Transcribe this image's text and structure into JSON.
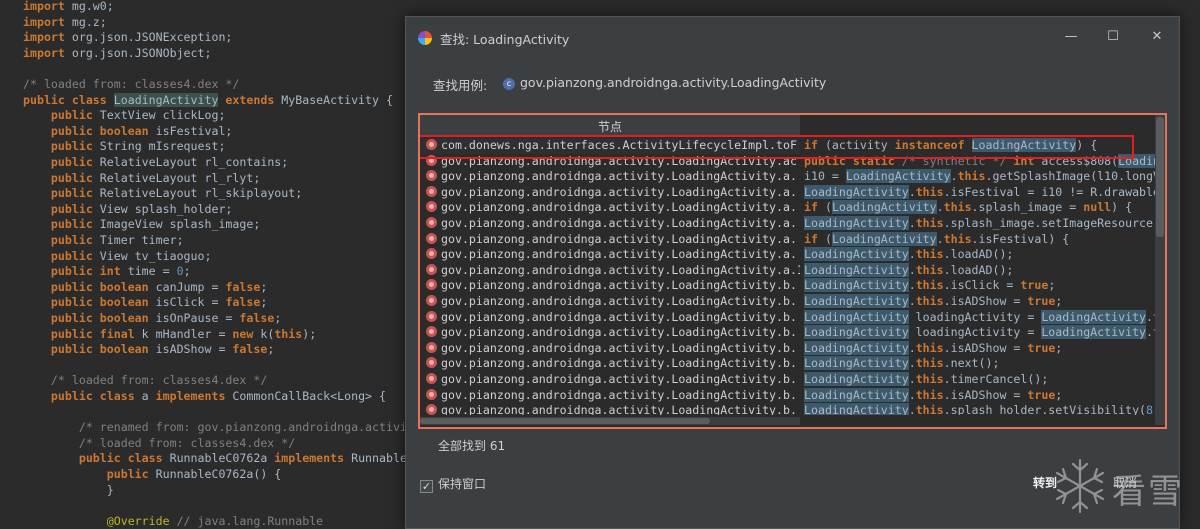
{
  "editor": {
    "lines": [
      {
        "parts": [
          {
            "t": "import",
            "c": "kw"
          },
          {
            "t": " mg.w0;"
          }
        ]
      },
      {
        "parts": [
          {
            "t": "import",
            "c": "kw"
          },
          {
            "t": " mg.z;"
          }
        ]
      },
      {
        "parts": [
          {
            "t": "import",
            "c": "kw"
          },
          {
            "t": " org.json.JSONException;"
          }
        ]
      },
      {
        "parts": [
          {
            "t": "import",
            "c": "kw"
          },
          {
            "t": " org.json.JSONObject;"
          }
        ]
      },
      {
        "parts": [
          {
            "t": ""
          }
        ]
      },
      {
        "parts": [
          {
            "t": "/* loaded from: classes4.dex */",
            "c": "cm"
          }
        ]
      },
      {
        "parts": [
          {
            "t": "public class ",
            "c": "kw"
          },
          {
            "t": "LoadingActivity",
            "c": "hl-sel"
          },
          {
            "t": " extends ",
            "c": "kw"
          },
          {
            "t": "MyBaseActivity {"
          }
        ]
      },
      {
        "parts": [
          {
            "t": "    "
          },
          {
            "t": "public",
            "c": "kw"
          },
          {
            "t": " TextView clickLog;"
          }
        ]
      },
      {
        "parts": [
          {
            "t": "    "
          },
          {
            "t": "public boolean",
            "c": "kw"
          },
          {
            "t": " isFestival;"
          }
        ]
      },
      {
        "parts": [
          {
            "t": "    "
          },
          {
            "t": "public",
            "c": "kw"
          },
          {
            "t": " String mIsrequest;"
          }
        ]
      },
      {
        "parts": [
          {
            "t": "    "
          },
          {
            "t": "public",
            "c": "kw"
          },
          {
            "t": " RelativeLayout rl_contains;"
          }
        ]
      },
      {
        "parts": [
          {
            "t": "    "
          },
          {
            "t": "public",
            "c": "kw"
          },
          {
            "t": " RelativeLayout rl_rlyt;"
          }
        ]
      },
      {
        "parts": [
          {
            "t": "    "
          },
          {
            "t": "public",
            "c": "kw"
          },
          {
            "t": " RelativeLayout rl_skiplayout;"
          }
        ]
      },
      {
        "parts": [
          {
            "t": "    "
          },
          {
            "t": "public",
            "c": "kw"
          },
          {
            "t": " View splash_holder;"
          }
        ]
      },
      {
        "parts": [
          {
            "t": "    "
          },
          {
            "t": "public",
            "c": "kw"
          },
          {
            "t": " ImageView splash_image;"
          }
        ]
      },
      {
        "parts": [
          {
            "t": "    "
          },
          {
            "t": "public",
            "c": "kw"
          },
          {
            "t": " Timer timer;"
          }
        ]
      },
      {
        "parts": [
          {
            "t": "    "
          },
          {
            "t": "public",
            "c": "kw"
          },
          {
            "t": " View tv_tiaoguo;"
          }
        ]
      },
      {
        "parts": [
          {
            "t": "    "
          },
          {
            "t": "public int",
            "c": "kw"
          },
          {
            "t": " time = "
          },
          {
            "t": "0",
            "c": "num"
          },
          {
            "t": ";"
          }
        ]
      },
      {
        "parts": [
          {
            "t": "    "
          },
          {
            "t": "public boolean",
            "c": "kw"
          },
          {
            "t": " canJump = "
          },
          {
            "t": "false",
            "c": "kw"
          },
          {
            "t": ";"
          }
        ]
      },
      {
        "parts": [
          {
            "t": "    "
          },
          {
            "t": "public boolean",
            "c": "kw"
          },
          {
            "t": " isClick = "
          },
          {
            "t": "false",
            "c": "kw"
          },
          {
            "t": ";"
          }
        ]
      },
      {
        "parts": [
          {
            "t": "    "
          },
          {
            "t": "public boolean",
            "c": "kw"
          },
          {
            "t": " isOnPause = "
          },
          {
            "t": "false",
            "c": "kw"
          },
          {
            "t": ";"
          }
        ]
      },
      {
        "parts": [
          {
            "t": "    "
          },
          {
            "t": "public final",
            "c": "kw"
          },
          {
            "t": " k mHandler = "
          },
          {
            "t": "new",
            "c": "kw"
          },
          {
            "t": " k("
          },
          {
            "t": "this",
            "c": "kw"
          },
          {
            "t": ");"
          }
        ]
      },
      {
        "parts": [
          {
            "t": "    "
          },
          {
            "t": "public boolean",
            "c": "kw"
          },
          {
            "t": " isADShow = "
          },
          {
            "t": "false",
            "c": "kw"
          },
          {
            "t": ";"
          }
        ]
      },
      {
        "parts": [
          {
            "t": ""
          }
        ]
      },
      {
        "parts": [
          {
            "t": "    "
          },
          {
            "t": "/* loaded from: classes4.dex */",
            "c": "cm"
          }
        ]
      },
      {
        "parts": [
          {
            "t": "    "
          },
          {
            "t": "public class",
            "c": "kw"
          },
          {
            "t": " a "
          },
          {
            "t": "implements",
            "c": "kw"
          },
          {
            "t": " CommonCallBack<Long> {"
          }
        ]
      },
      {
        "parts": [
          {
            "t": ""
          }
        ]
      },
      {
        "parts": [
          {
            "t": "        "
          },
          {
            "t": "/* renamed from: gov.pianzong.androidnga.activit",
            "c": "cm"
          }
        ]
      },
      {
        "parts": [
          {
            "t": "        "
          },
          {
            "t": "/* loaded from: classes4.dex */",
            "c": "cm"
          }
        ]
      },
      {
        "parts": [
          {
            "t": "        "
          },
          {
            "t": "public class",
            "c": "kw"
          },
          {
            "t": " RunnableC0762a "
          },
          {
            "t": "implements",
            "c": "kw"
          },
          {
            "t": " Runnable"
          }
        ]
      },
      {
        "parts": [
          {
            "t": "            "
          },
          {
            "t": "public",
            "c": "kw"
          },
          {
            "t": " RunnableC0762a() {"
          }
        ]
      },
      {
        "parts": [
          {
            "t": "            }"
          }
        ]
      },
      {
        "parts": [
          {
            "t": ""
          }
        ]
      },
      {
        "parts": [
          {
            "t": "            "
          },
          {
            "t": "@Override",
            "c": "ann"
          },
          {
            "t": " // java.lang.Runnable",
            "c": "cm"
          }
        ]
      }
    ]
  },
  "dialog": {
    "title": "查找: LoadingActivity",
    "minimize": "—",
    "maximize": "☐",
    "close": "✕",
    "use_label": "查找用例:",
    "class_icon_letter": "c",
    "use_target": "gov.pianzong.androidnga.activity.LoadingActivity",
    "column_header": "节点",
    "nodes": [
      "com.donews.nga.interfaces.ActivityLifecycleImpl.toF",
      "gov.pianzong.androidnga.activity.LoadingActivity.ac",
      "gov.pianzong.androidnga.activity.LoadingActivity.a.",
      "gov.pianzong.androidnga.activity.LoadingActivity.a.",
      "gov.pianzong.androidnga.activity.LoadingActivity.a.",
      "gov.pianzong.androidnga.activity.LoadingActivity.a.",
      "gov.pianzong.androidnga.activity.LoadingActivity.a.",
      "gov.pianzong.androidnga.activity.LoadingActivity.a.",
      "gov.pianzong.androidnga.activity.LoadingActivity.a.I",
      "gov.pianzong.androidnga.activity.LoadingActivity.b.",
      "gov.pianzong.androidnga.activity.LoadingActivity.b.",
      "gov.pianzong.androidnga.activity.LoadingActivity.b.",
      "gov.pianzong.androidnga.activity.LoadingActivity.b.",
      "gov.pianzong.androidnga.activity.LoadingActivity.b.",
      "gov.pianzong.androidnga.activity.LoadingActivity.b.",
      "gov.pianzong.androidnga.activity.LoadingActivity.b.",
      "gov.pianzong.androidnga.activity.LoadingActivity.b.",
      "gov.pianzong.androidnga.activity.LoadingActivity.b.",
      "gov.pianzong.androidnga.activity.LoadingActivity.b.",
      "gov.pianzong.androidnga.activity.LoadingActivity.b."
    ],
    "code_lines": [
      {
        "parts": [
          {
            "t": "if",
            "c": "kw"
          },
          {
            "t": " (activity "
          },
          {
            "t": "instanceof",
            "c": "kw"
          },
          {
            "t": " "
          },
          {
            "t": "LoadingActivity",
            "c": "cvh"
          },
          {
            "t": ") {"
          }
        ]
      },
      {
        "parts": [
          {
            "t": "public static",
            "c": "kw"
          },
          {
            "t": " /* synthetic */",
            "c": "cm"
          },
          {
            "t": " "
          },
          {
            "t": "int",
            "c": "kw"
          },
          {
            "t": " access$808("
          },
          {
            "t": "Loading",
            "c": "cvh"
          }
        ]
      },
      {
        "parts": [
          {
            "t": "i10 = "
          },
          {
            "t": "LoadingActivity",
            "c": "cvh"
          },
          {
            "t": "."
          },
          {
            "t": "this",
            "c": "kw"
          },
          {
            "t": ".getSplashImage(l10.longVa"
          }
        ]
      },
      {
        "parts": [
          {
            "t": "LoadingActivity",
            "c": "cvh"
          },
          {
            "t": "."
          },
          {
            "t": "this",
            "c": "kw"
          },
          {
            "t": ".isFestival = i10 != R.drawable"
          }
        ]
      },
      {
        "parts": [
          {
            "t": "if",
            "c": "kw"
          },
          {
            "t": " ("
          },
          {
            "t": "LoadingActivity",
            "c": "cvh"
          },
          {
            "t": "."
          },
          {
            "t": "this",
            "c": "kw"
          },
          {
            "t": ".splash_image = "
          },
          {
            "t": "null",
            "c": "kw"
          },
          {
            "t": ") {"
          }
        ]
      },
      {
        "parts": [
          {
            "t": "LoadingActivity",
            "c": "cvh"
          },
          {
            "t": "."
          },
          {
            "t": "this",
            "c": "kw"
          },
          {
            "t": ".splash_image.setImageResource(i"
          }
        ]
      },
      {
        "parts": [
          {
            "t": "if",
            "c": "kw"
          },
          {
            "t": " ("
          },
          {
            "t": "LoadingActivity",
            "c": "cvh"
          },
          {
            "t": "."
          },
          {
            "t": "this",
            "c": "kw"
          },
          {
            "t": ".isFestival) {"
          }
        ]
      },
      {
        "parts": [
          {
            "t": "LoadingActivity",
            "c": "cvh"
          },
          {
            "t": "."
          },
          {
            "t": "this",
            "c": "kw"
          },
          {
            "t": ".loadAD();"
          }
        ]
      },
      {
        "parts": [
          {
            "t": "LoadingActivity",
            "c": "cvh"
          },
          {
            "t": "."
          },
          {
            "t": "this",
            "c": "kw"
          },
          {
            "t": ".loadAD();"
          }
        ]
      },
      {
        "parts": [
          {
            "t": "LoadingActivity",
            "c": "cvh"
          },
          {
            "t": "."
          },
          {
            "t": "this",
            "c": "kw"
          },
          {
            "t": ".isClick = "
          },
          {
            "t": "true",
            "c": "kw"
          },
          {
            "t": ";"
          }
        ]
      },
      {
        "parts": [
          {
            "t": "LoadingActivity",
            "c": "cvh"
          },
          {
            "t": "."
          },
          {
            "t": "this",
            "c": "kw"
          },
          {
            "t": ".isADShow = "
          },
          {
            "t": "true",
            "c": "kw"
          },
          {
            "t": ";"
          }
        ]
      },
      {
        "parts": [
          {
            "t": "LoadingActivity",
            "c": "cvh"
          },
          {
            "t": " loadingActivity = "
          },
          {
            "t": "LoadingActivity",
            "c": "cvh"
          },
          {
            "t": ".th"
          }
        ]
      },
      {
        "parts": [
          {
            "t": "LoadingActivity",
            "c": "cvh"
          },
          {
            "t": " loadingActivity = "
          },
          {
            "t": "LoadingActivity",
            "c": "cvh"
          },
          {
            "t": ".th"
          }
        ]
      },
      {
        "parts": [
          {
            "t": "LoadingActivity",
            "c": "cvh"
          },
          {
            "t": "."
          },
          {
            "t": "this",
            "c": "kw"
          },
          {
            "t": ".isADShow = "
          },
          {
            "t": "true",
            "c": "kw"
          },
          {
            "t": ";"
          }
        ]
      },
      {
        "parts": [
          {
            "t": "LoadingActivity",
            "c": "cvh"
          },
          {
            "t": "."
          },
          {
            "t": "this",
            "c": "kw"
          },
          {
            "t": ".next();"
          }
        ]
      },
      {
        "parts": [
          {
            "t": "LoadingActivity",
            "c": "cvh"
          },
          {
            "t": "."
          },
          {
            "t": "this",
            "c": "kw"
          },
          {
            "t": ".timerCancel();"
          }
        ]
      },
      {
        "parts": [
          {
            "t": "LoadingActivity",
            "c": "cvh"
          },
          {
            "t": "."
          },
          {
            "t": "this",
            "c": "kw"
          },
          {
            "t": ".isADShow = "
          },
          {
            "t": "true",
            "c": "kw"
          },
          {
            "t": ";"
          }
        ]
      },
      {
        "parts": [
          {
            "t": "LoadingActivity",
            "c": "cvh"
          },
          {
            "t": "."
          },
          {
            "t": "this",
            "c": "kw"
          },
          {
            "t": ".splash_holder.setVisibility("
          },
          {
            "t": "8",
            "c": "num"
          },
          {
            "t": ")"
          }
        ]
      }
    ],
    "found_text": "全部找到 61",
    "keep_window_label": "保持窗口",
    "keep_window_checked": "✓",
    "goto_label": "转到",
    "cancel_label": "取消"
  },
  "watermark": {
    "text": "看雪"
  }
}
